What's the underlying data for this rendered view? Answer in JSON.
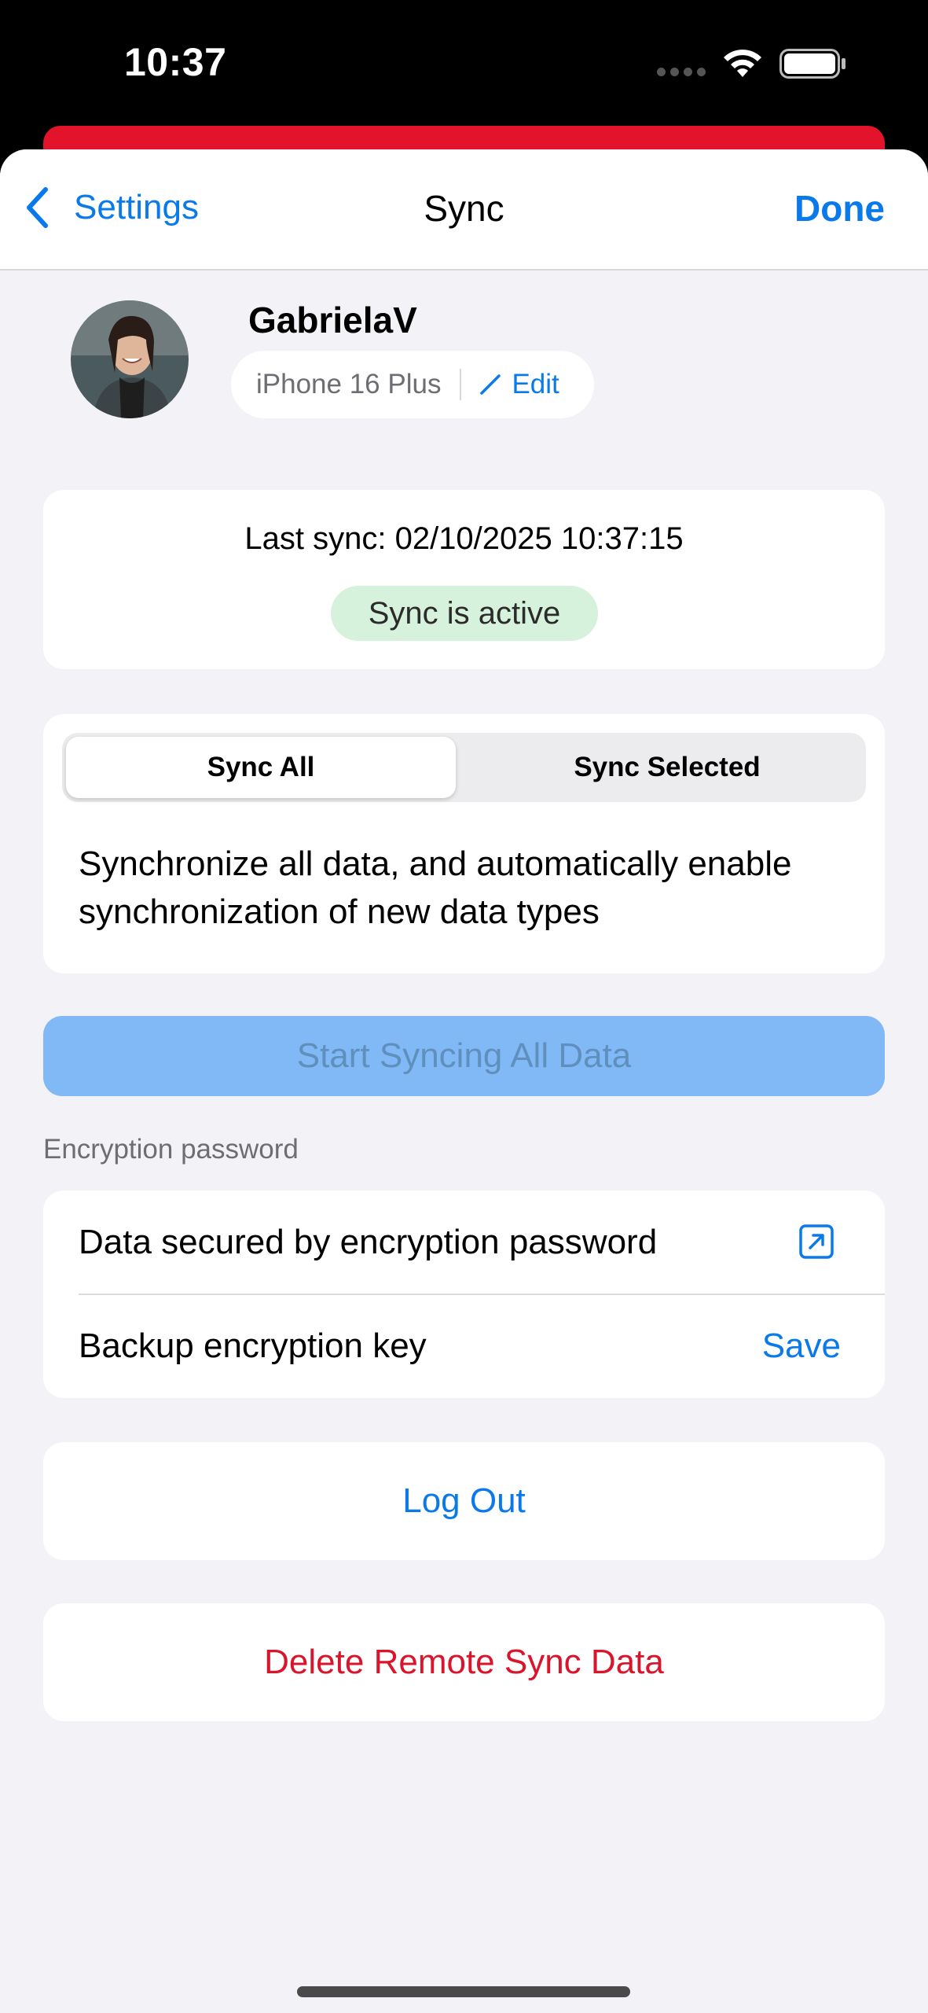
{
  "status_bar": {
    "time": "10:37"
  },
  "nav": {
    "back_label": "Settings",
    "title": "Sync",
    "done_label": "Done"
  },
  "profile": {
    "username": "GabrielaV",
    "device": "iPhone 16 Plus",
    "edit_label": "Edit"
  },
  "sync_status": {
    "last_sync": "Last sync: 02/10/2025 10:37:15",
    "badge": "Sync is active"
  },
  "mode": {
    "options": [
      "Sync All",
      "Sync Selected"
    ],
    "selected": "Sync All",
    "description": "Synchronize all data, and automatically enable synchronization of new data types"
  },
  "start_button": "Start Syncing All Data",
  "encryption": {
    "header": "Encryption password",
    "row1_label": "Data secured by encryption password",
    "row2_label": "Backup encryption key",
    "row2_action": "Save"
  },
  "logout_label": "Log Out",
  "delete_label": "Delete Remote Sync Data",
  "colors": {
    "accent": "#0a7aeb",
    "destructive": "#d9142b",
    "active_badge": "#d7f2dc",
    "top_strip": "#e3132b"
  }
}
